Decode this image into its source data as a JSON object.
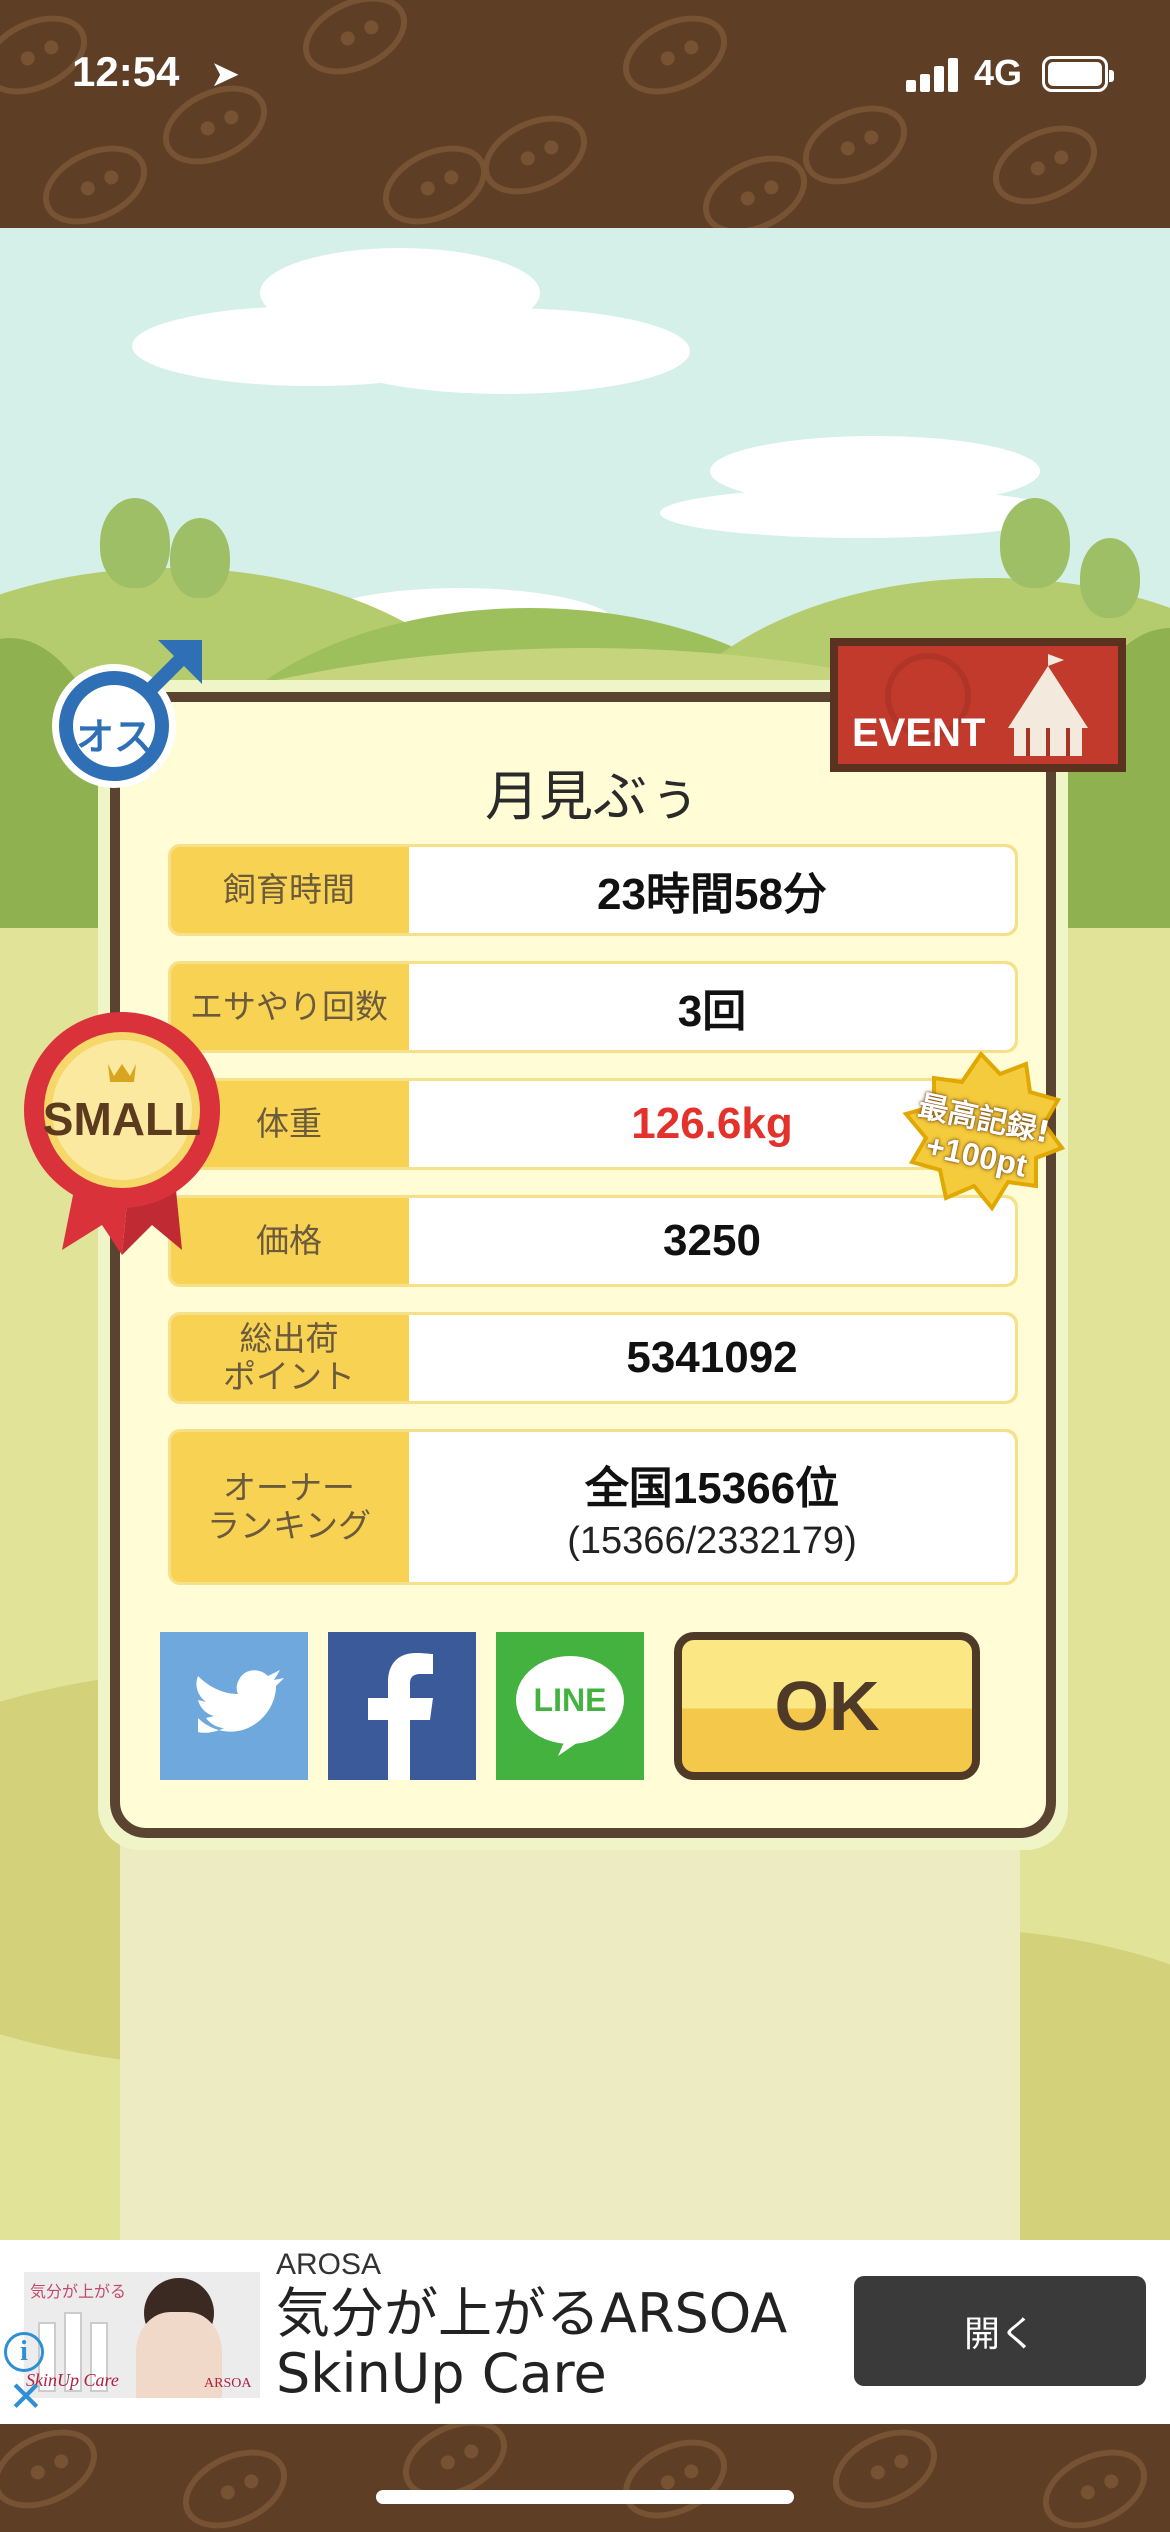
{
  "status_bar": {
    "time": "12:54",
    "network": "4G"
  },
  "pig": {
    "gender": "オス",
    "name": "月見ぶぅ",
    "event_label": "EVENT",
    "size_badge": "SMALL",
    "record_badge": {
      "line1": "最高記録!",
      "line2": "+100pt"
    }
  },
  "stats": [
    {
      "label": "飼育時間",
      "value": "23時間58分"
    },
    {
      "label": "エサやり回数",
      "value": "3回"
    },
    {
      "label": "体重",
      "value": "126.6kg"
    },
    {
      "label": "価格",
      "value": "3250"
    },
    {
      "label": "総出荷\nポイント",
      "value": "5341092"
    },
    {
      "label": "オーナー\nランキング",
      "value": "全国15366位",
      "sub": "(15366/2332179)"
    }
  ],
  "share": {
    "line_label": "LINE",
    "ok_label": "OK"
  },
  "ad": {
    "brand": "AROSA",
    "headline_1": "気分が上がるARSOA",
    "headline_2": "SkinUp Care",
    "open_label": "開く",
    "image_text_1": "気分が上がる",
    "image_text_2": "SkinUp Care",
    "image_logo": "ARSOA"
  },
  "colors": {
    "weight_value": "#e3322b",
    "label_bg": "#f8d353",
    "frame": "#5b4331"
  }
}
